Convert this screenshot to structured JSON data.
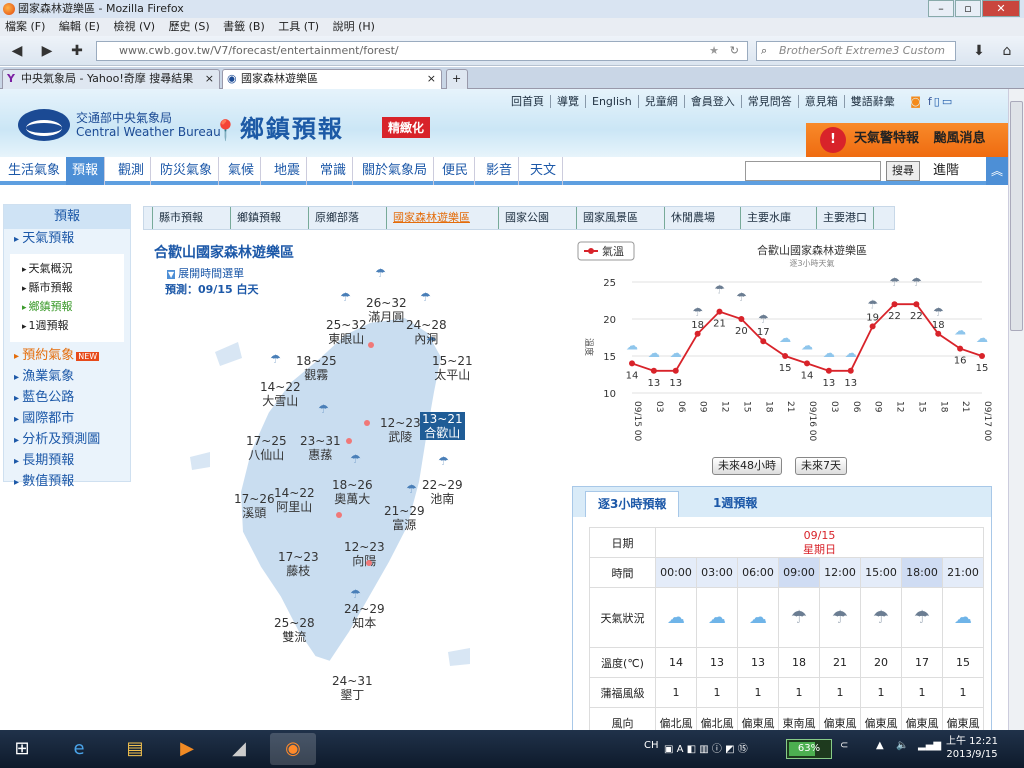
{
  "window": {
    "title": "國家森林遊樂區 - Mozilla Firefox"
  },
  "menu": [
    "檔案 (F)",
    "編輯 (E)",
    "檢視 (V)",
    "歷史 (S)",
    "書籤 (B)",
    "工具 (T)",
    "說明 (H)"
  ],
  "browser": {
    "url": "www.cwb.gov.tw/V7/forecast/entertainment/forest/",
    "search_placeholder": "BrotherSoft Extreme3 Custom",
    "tabs": [
      {
        "label": "中央氣象局 - Yahoo!奇摩 搜尋結果",
        "active": false
      },
      {
        "label": "國家森林遊樂區",
        "active": true
      }
    ],
    "new_tab": "+"
  },
  "header": {
    "agency_zh": "交通部中央氣象局",
    "agency_en": "Central Weather Bureau",
    "banner": "鄉鎮預報",
    "banner_badge": "精緻化",
    "top_links": [
      "回首頁",
      "導覽",
      "English",
      "兒童網",
      "會員登入",
      "常見問答",
      "意見箱",
      "雙語辭彙"
    ],
    "alert_label": "天氣警特報",
    "alert_link": "颱風消息"
  },
  "main_nav": {
    "items": [
      "生活氣象",
      "預報",
      "觀測",
      "防災氣象",
      "氣候",
      "地震",
      "常識",
      "關於氣象局",
      "便民",
      "影音",
      "天文"
    ],
    "active_index": 1,
    "search_button": "搜尋",
    "advanced": "進階"
  },
  "sidebar": {
    "title": "預報",
    "weather_forecast": "天氣預報",
    "sub_items": [
      "天氣概況",
      "縣市預報",
      "鄉鎮預報",
      "1週預報"
    ],
    "active_sub": 2,
    "items": [
      "預約氣象",
      "漁業氣象",
      "藍色公路",
      "國際都市",
      "分析及預測圖",
      "長期預報",
      "數值預報"
    ],
    "new_badge": "NEW"
  },
  "sub_nav": {
    "items": [
      "縣市預報",
      "鄉鎮預報",
      "原鄉部落",
      "國家森林遊樂區",
      "國家公園",
      "國家風景區",
      "休閒農場",
      "主要水庫",
      "主要港口"
    ],
    "active_index": 3
  },
  "area": {
    "title": "合歡山國家森林遊樂區",
    "time_toggle": "展開時間選單",
    "forecast_label": "預測：09/15 白天"
  },
  "map_locations": [
    {
      "name": "滿月圓",
      "temp": "26~32"
    },
    {
      "name": "東眼山",
      "temp": "25~32"
    },
    {
      "name": "內洞",
      "temp": "24~28"
    },
    {
      "name": "觀霧",
      "temp": "18~25"
    },
    {
      "name": "太平山",
      "temp": "15~21"
    },
    {
      "name": "大雪山",
      "temp": "14~22"
    },
    {
      "name": "武陵",
      "temp": "12~23"
    },
    {
      "name": "合歡山",
      "temp": "13~21"
    },
    {
      "name": "八仙山",
      "temp": "17~25"
    },
    {
      "name": "惠蓀",
      "temp": "23~31"
    },
    {
      "name": "奧萬大",
      "temp": "18~26"
    },
    {
      "name": "池南",
      "temp": "22~29"
    },
    {
      "name": "溪頭",
      "temp": "17~26"
    },
    {
      "name": "阿里山",
      "temp": "14~22"
    },
    {
      "name": "富源",
      "temp": "21~29"
    },
    {
      "name": "向陽",
      "temp": "12~23"
    },
    {
      "name": "藤枝",
      "temp": "17~23"
    },
    {
      "name": "雙流",
      "temp": "25~28"
    },
    {
      "name": "知本",
      "temp": "24~29"
    },
    {
      "name": "墾丁",
      "temp": "24~31"
    }
  ],
  "chart_data": {
    "type": "line",
    "title": "合歡山國家森林遊樂區",
    "subtitle": "逐3小時天氣",
    "ylabel": "溫度",
    "legend": "氣溫",
    "legend_position": "top-left",
    "ylim": [
      10,
      25
    ],
    "yticks": [
      10,
      15,
      20,
      25
    ],
    "x": [
      "09/15 00",
      "03",
      "06",
      "09",
      "12",
      "15",
      "18",
      "21",
      "09/16 00",
      "03",
      "06",
      "09",
      "12",
      "15",
      "18",
      "21",
      "09/17 00"
    ],
    "series": [
      {
        "name": "氣溫",
        "values": [
          14,
          13,
          13,
          18,
          21,
          20,
          17,
          15,
          14,
          13,
          13,
          19,
          22,
          22,
          18,
          16,
          15
        ]
      }
    ],
    "color": "#d8232a",
    "grid": true
  },
  "chart_buttons": [
    "未來48小時",
    "未來7天"
  ],
  "table_panel": {
    "tabs": [
      "逐3小時預報",
      "1週預報"
    ],
    "date_label": "日期",
    "date": "09/15",
    "weekday": "星期日",
    "time_label": "時間",
    "times": [
      "00:00",
      "03:00",
      "06:00",
      "09:00",
      "12:00",
      "15:00",
      "18:00",
      "21:00"
    ],
    "weather_label": "天氣狀況",
    "weather_icons": [
      "cloudy-icon",
      "cloudy-icon",
      "cloudy-icon",
      "rain-icon",
      "rain-icon",
      "rain-icon",
      "rain-icon",
      "cloudy-icon"
    ],
    "temp_label": "溫度(℃)",
    "temps": [
      "14",
      "13",
      "13",
      "18",
      "21",
      "20",
      "17",
      "15"
    ],
    "beaufort_label": "蒲福風級",
    "beaufort": [
      "1",
      "1",
      "1",
      "1",
      "1",
      "1",
      "1",
      "1"
    ],
    "wind_label": "風向",
    "wind": [
      "偏北風",
      "偏北風",
      "偏東風",
      "東南風",
      "偏東風",
      "偏東風",
      "偏東風",
      "偏東風"
    ]
  },
  "taskbar": {
    "lang": "CH",
    "battery": "63%",
    "clock_time": "上午 12:21",
    "clock_date": "2013/9/15"
  }
}
